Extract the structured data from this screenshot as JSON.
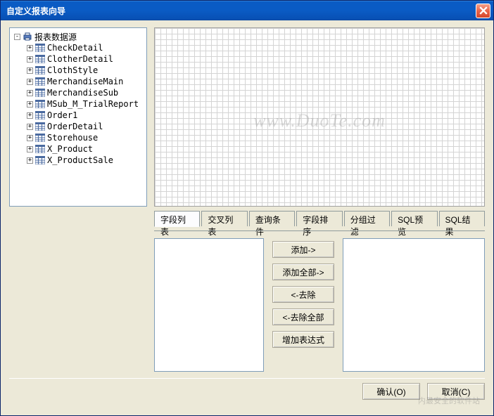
{
  "window": {
    "title": "自定义报表向导"
  },
  "tree": {
    "root_label": "报表数据源",
    "items": [
      "CheckDetail",
      "ClotherDetail",
      "ClothStyle",
      "MerchandiseMain",
      "MerchandiseSub",
      "MSub_M_TrialReport",
      "Order1",
      "OrderDetail",
      "Storehouse",
      "X_Product",
      "X_ProductSale"
    ]
  },
  "watermark": "www.DuoTe.com",
  "tabs": [
    "字段列表",
    "交叉列表",
    "查询条件",
    "字段排序",
    "分组过滤",
    "SQL预览",
    "SQL结果"
  ],
  "actions": {
    "add": "添加->",
    "add_all": "添加全部->",
    "remove": "<-去除",
    "remove_all": "<-去除全部",
    "add_expr": "增加表达式"
  },
  "buttons": {
    "ok": "确认(O)",
    "cancel": "取消(C)"
  },
  "footer_wm": "内最安全的软件站"
}
